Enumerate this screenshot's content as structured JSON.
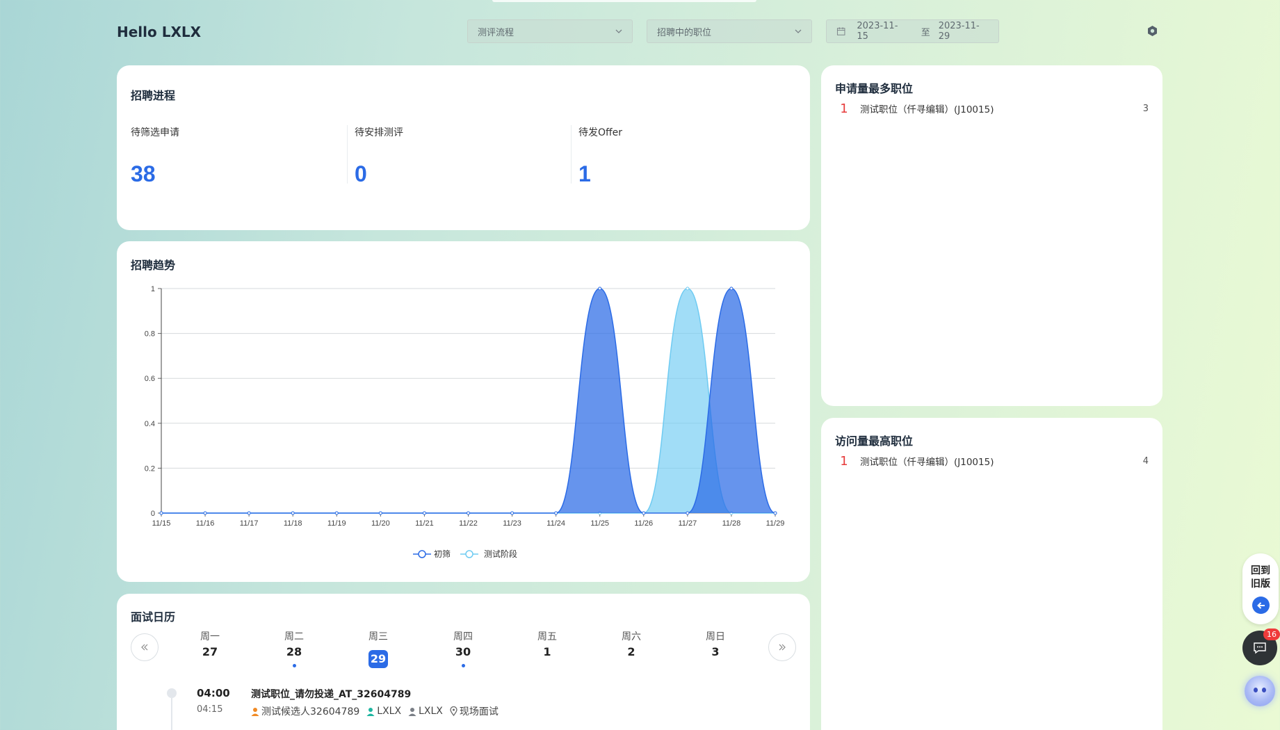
{
  "header": {
    "greeting": "Hello LXLX",
    "process_select": "测评流程",
    "position_select": "招聘中的职位",
    "date_start": "2023-11-15",
    "date_sep": "至",
    "date_end": "2023-11-29"
  },
  "progress": {
    "title": "招聘进程",
    "stats": [
      {
        "label": "待筛选申请",
        "value": "38"
      },
      {
        "label": "待安排测评",
        "value": "0"
      },
      {
        "label": "待发Offer",
        "value": "1"
      }
    ]
  },
  "trend": {
    "title": "招聘趋势",
    "chart_data": {
      "type": "area",
      "x": [
        "11/15",
        "11/16",
        "11/17",
        "11/18",
        "11/19",
        "11/20",
        "11/21",
        "11/22",
        "11/23",
        "11/24",
        "11/25",
        "11/26",
        "11/27",
        "11/28",
        "11/29"
      ],
      "ylim": [
        0,
        1
      ],
      "yticks": [
        "0",
        "0.2",
        "0.4",
        "0.6",
        "0.8",
        "1"
      ],
      "series": [
        {
          "name": "初筛",
          "values": [
            0,
            0,
            0,
            0,
            0,
            0,
            0,
            0,
            0,
            0,
            1,
            0,
            0,
            1,
            0
          ],
          "color": "#2b6be6"
        },
        {
          "name": "测试阶段",
          "values": [
            0,
            0,
            0,
            0,
            0,
            0,
            0,
            0,
            0,
            0,
            0,
            0,
            1,
            0,
            0
          ],
          "color": "#6fcbf2"
        }
      ],
      "grid": true,
      "legend": "bottom"
    }
  },
  "top_applied": {
    "title": "申请量最多职位",
    "items": [
      {
        "rank": "1",
        "name": "测试职位（仟寻编辑）(J10015)",
        "count": "3"
      }
    ]
  },
  "top_visited": {
    "title": "访问量最高职位",
    "items": [
      {
        "rank": "1",
        "name": "测试职位（仟寻编辑）(J10015)",
        "count": "4"
      }
    ]
  },
  "calendar": {
    "title": "面试日历",
    "days": [
      {
        "weekday": "周一",
        "date": "27",
        "dot": false,
        "selected": false
      },
      {
        "weekday": "周二",
        "date": "28",
        "dot": true,
        "selected": false
      },
      {
        "weekday": "周三",
        "date": "29",
        "dot": false,
        "selected": true
      },
      {
        "weekday": "周四",
        "date": "30",
        "dot": true,
        "selected": false
      },
      {
        "weekday": "周五",
        "date": "1",
        "dot": false,
        "selected": false
      },
      {
        "weekday": "周六",
        "date": "2",
        "dot": false,
        "selected": false
      },
      {
        "weekday": "周日",
        "date": "3",
        "dot": false,
        "selected": false
      }
    ],
    "event": {
      "start": "04:00",
      "end": "04:15",
      "title": "测试职位_请勿投递_AT_32604789",
      "candidate": "测试候选人32604789",
      "interviewer1": "LXLX",
      "interviewer2": "LXLX",
      "location": "现场面试"
    }
  },
  "floating": {
    "old_version": "回到旧版",
    "chat_badge": "16"
  },
  "colors": {
    "accent": "#2b6be6",
    "rank": "#e63b3b"
  }
}
